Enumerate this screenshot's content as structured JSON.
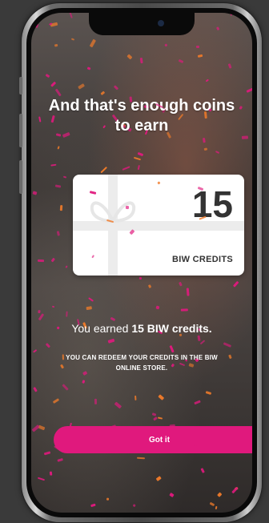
{
  "modal": {
    "title_line1": "And that's enough coins",
    "title_line2": "to earn",
    "card": {
      "amount": "15",
      "unit_label": "BIW CREDITS",
      "icon": "gift-ribbon-icon"
    },
    "earned_prefix": "You earned ",
    "earned_bold": "15 BIW credits.",
    "note_line1": "YOU CAN REDEEM YOUR CREDITS IN THE BIW",
    "note_line2": "ONLINE STORE.",
    "button_label": "Got it"
  },
  "colors": {
    "accent": "#e0197d",
    "confetti_pink": "#e0197d",
    "confetti_orange": "#f07b2a",
    "text": "#ffffff"
  }
}
